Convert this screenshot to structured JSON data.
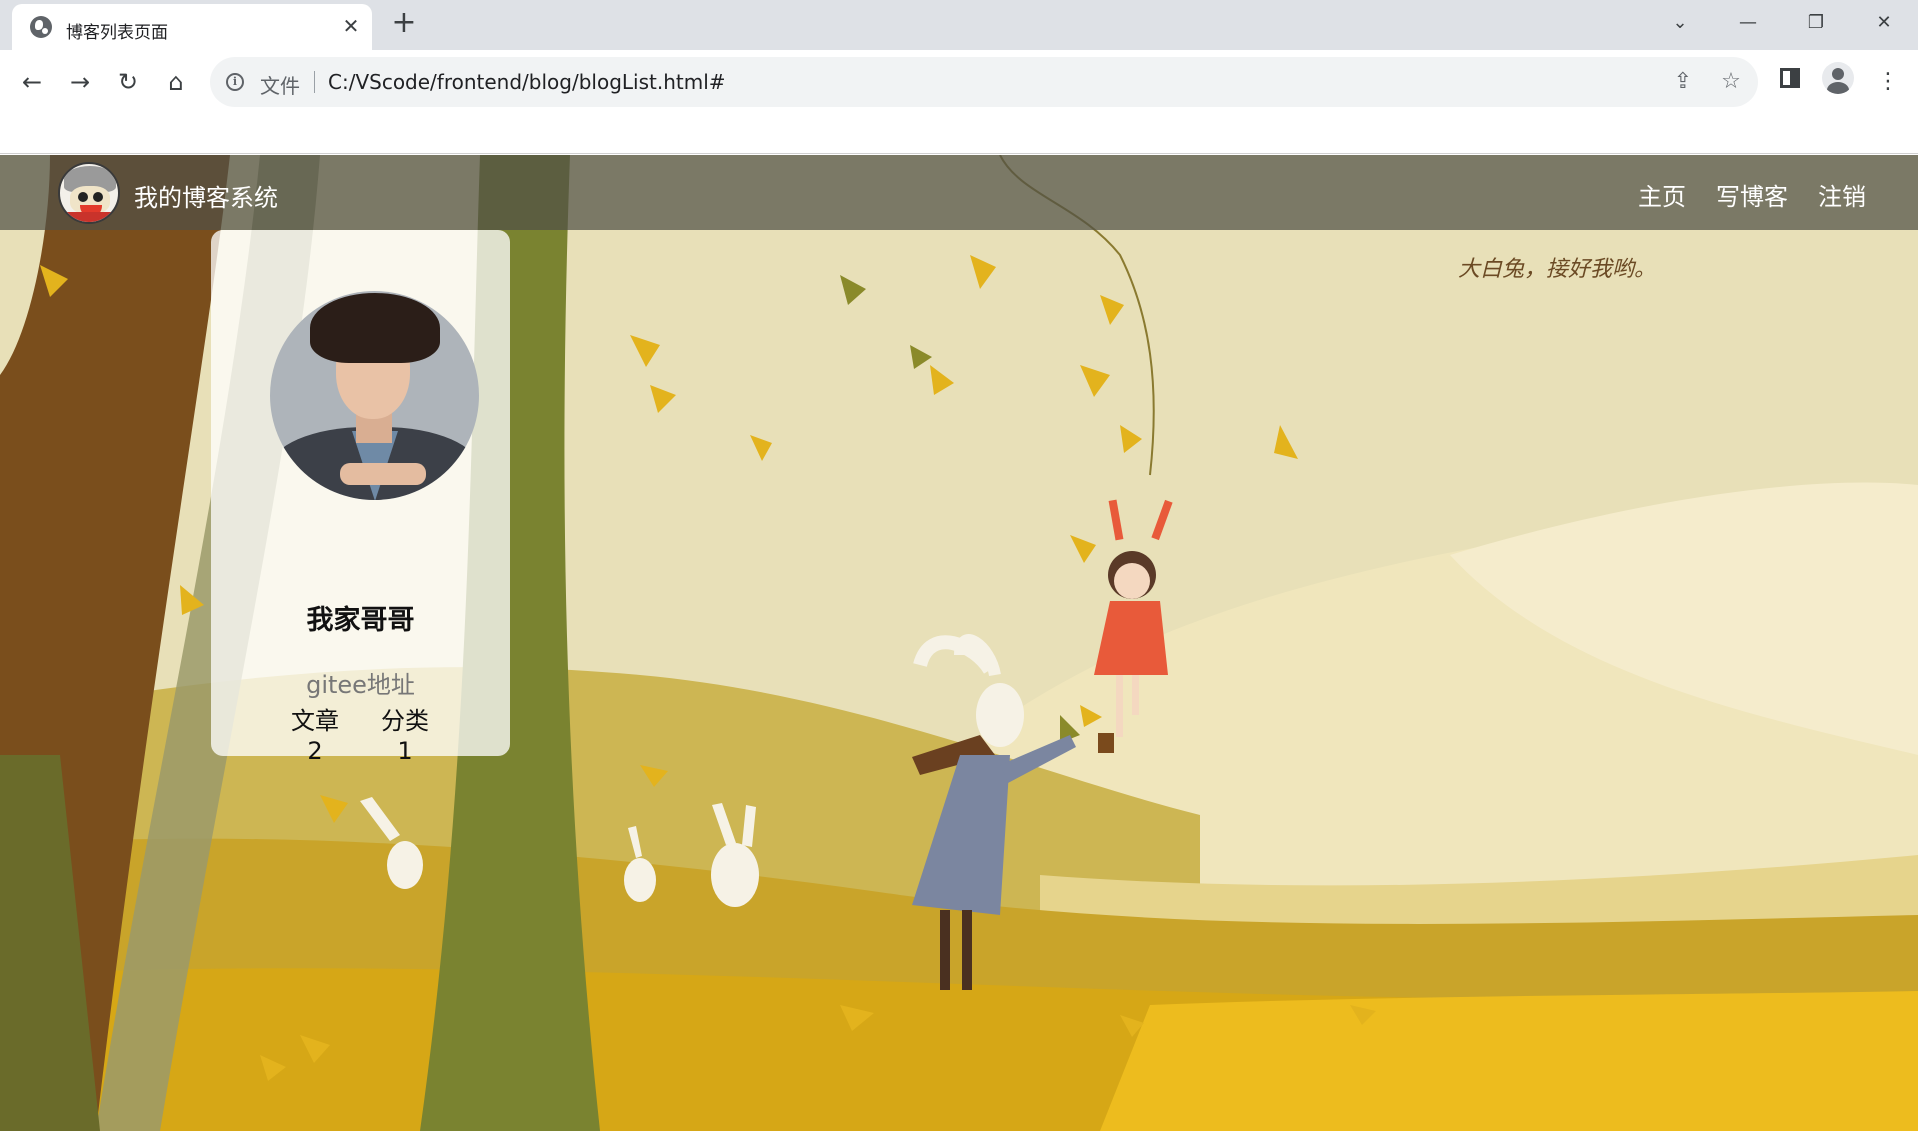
{
  "browser": {
    "tab_title": "博客列表页面",
    "tab_close": "✕",
    "new_tab": "+",
    "window_controls": {
      "dropdown": "⌄",
      "minimize": "—",
      "restore": "❐",
      "close": "✕"
    },
    "nav": {
      "back": "←",
      "forward": "→",
      "reload": "↻",
      "home": "⌂"
    },
    "omnibox": {
      "protocol_label": "文件",
      "url": "C:/VScode/frontend/blog/blogList.html#",
      "share_icon": "⇪",
      "star_icon": "☆"
    },
    "menu_icon": "⋮"
  },
  "navbar": {
    "site_title": "我的博客系统",
    "links": [
      "主页",
      "写博客",
      "注销"
    ]
  },
  "profile": {
    "name": "我家哥哥",
    "link": "gitee地址",
    "stats": [
      {
        "label": "文章",
        "value": "2"
      },
      {
        "label": "分类",
        "value": "1"
      }
    ]
  },
  "background": {
    "caption": "大白兔，接好我哟。"
  },
  "colors": {
    "navbar_bg": "#50504680",
    "sky": "#e8e0b8",
    "ground": "#d4a21a",
    "tree_brown": "#7a4e1c",
    "tree_green": "#7a8330",
    "girl_dress": "#e85a3a",
    "rabbit_coat": "#7b86a0"
  }
}
